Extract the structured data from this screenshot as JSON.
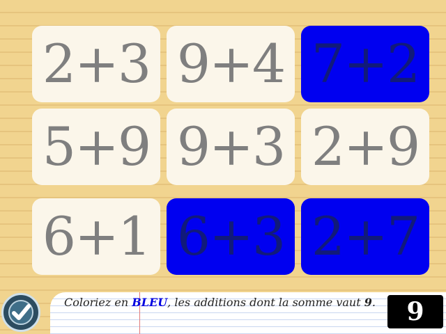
{
  "tiles": [
    {
      "label": "2+3",
      "selected": false
    },
    {
      "label": "9+4",
      "selected": false
    },
    {
      "label": "7+2",
      "selected": true
    },
    {
      "label": "5+9",
      "selected": false
    },
    {
      "label": "9+3",
      "selected": false
    },
    {
      "label": "2+9",
      "selected": false
    },
    {
      "label": "6+1",
      "selected": false
    },
    {
      "label": "6+3",
      "selected": true
    },
    {
      "label": "2+7",
      "selected": true
    }
  ],
  "instruction": {
    "prefix": "Coloriez en ",
    "color_word": "BLEU",
    "middle": ", les additions dont la somme vaut ",
    "target": "9",
    "suffix": "."
  },
  "target_value": "9",
  "colors": {
    "selected_tile": "#0000f0",
    "unselected_tile": "#fbf6ea",
    "background": "#f1d48f"
  },
  "icons": {
    "validate": "checkmark-icon"
  }
}
